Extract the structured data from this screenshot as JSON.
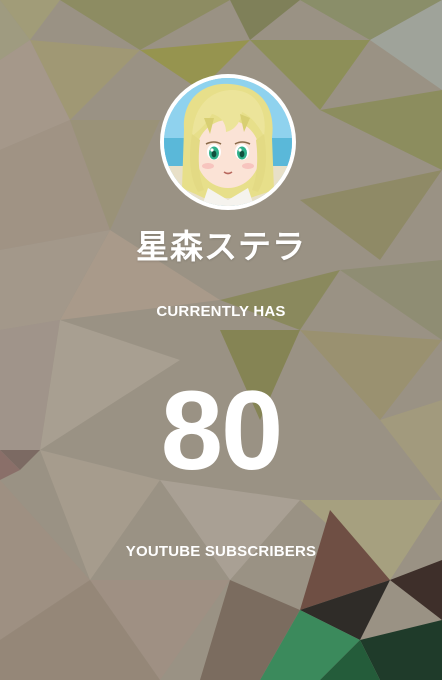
{
  "channel": {
    "name": "星森ステラ",
    "avatar_icon": "avatar-image"
  },
  "counter": {
    "label_top": "CURRENTLY HAS",
    "value": "80",
    "label_bottom": "YOUTUBE SUBSCRIBERS"
  },
  "theme": {
    "text_color": "#ffffff",
    "background_style": "low-poly olive and mauve triangles",
    "accent_green": "#3b8a5c"
  }
}
